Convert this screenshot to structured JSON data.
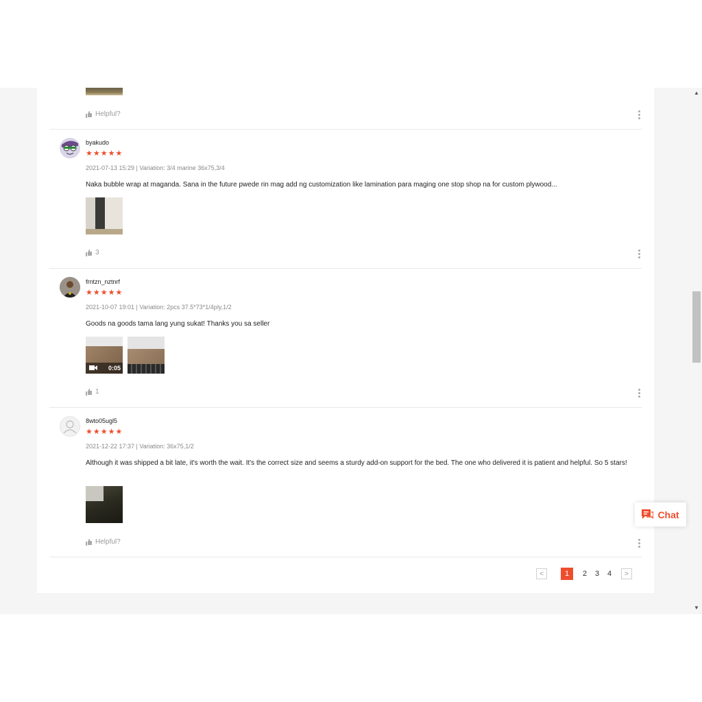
{
  "reviews": [
    {
      "author": "byakudo",
      "stars": "★★★★★",
      "meta": "2021-07-13 15:29 | Variation: 3/4 marine 36x75,3/4",
      "text": "Naka bubble wrap at maganda. Sana in the future pwede rin mag add ng customization like lamination para maging one stop shop na for custom plywood...",
      "likes": "3"
    },
    {
      "author": "frntzn_nztnrf",
      "stars": "★★★★★",
      "meta": "2021-10-07 19:01 | Variation: 2pcs 37.5*73*1/4ply,1/2",
      "text": "Goods na goods tama lang yung sukat! Thanks you sa seller",
      "video_duration": "0:05",
      "likes": "1"
    },
    {
      "author": "8wto05ugl5",
      "stars": "★★★★★",
      "meta": "2021-12-22 17:37 | Variation: 36x75,1/2",
      "text": "Although it was shipped a bit late, it's worth the wait. It's the correct size and seems a sturdy add-on support for the bed. The one who delivered it is patient and helpful. So 5 stars!",
      "likes": "Helpful?"
    }
  ],
  "first_helpful": "Helpful?",
  "pagination": {
    "prev": "<",
    "pages": [
      "1",
      "2",
      "3",
      "4"
    ],
    "next": ">"
  },
  "chat": {
    "label": "Chat"
  },
  "scroll": {
    "up": "▲",
    "down": "▼"
  },
  "colors": {
    "accent": "#ee4d2d"
  },
  "icons": {
    "helpful": "thumbs-up-icon",
    "more": "kebab-menu-icon",
    "chat": "chat-icon"
  }
}
